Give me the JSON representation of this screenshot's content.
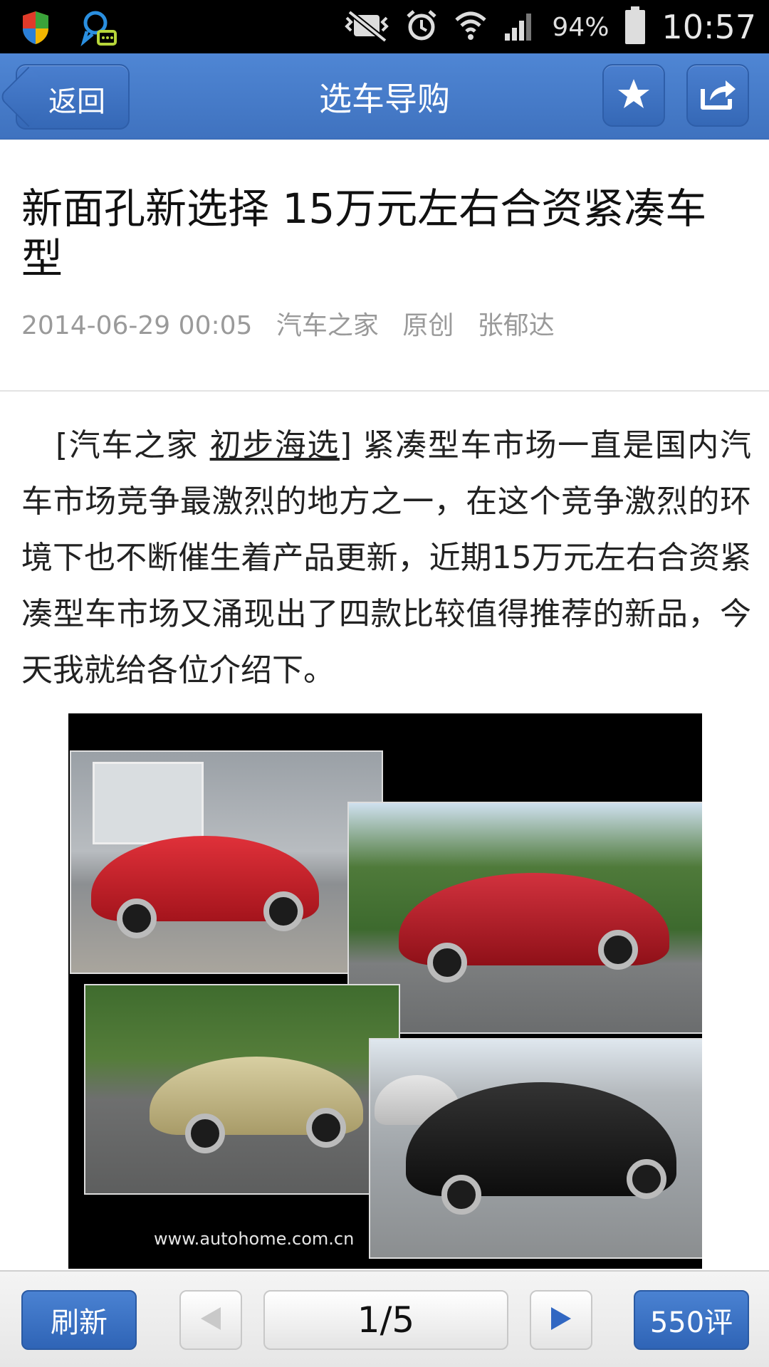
{
  "status_bar": {
    "battery_percent": "94%",
    "time": "10:57",
    "icons": [
      "shield-icon",
      "chat-notification-icon",
      "mute-icon",
      "alarm-icon",
      "wifi-icon",
      "signal-icon",
      "battery-icon"
    ]
  },
  "header": {
    "back_label": "返回",
    "title": "选车导购",
    "actions": [
      "star-icon",
      "share-icon"
    ]
  },
  "article": {
    "title": "新面孔新选择 15万元左右合资紧凑车型",
    "date": "2014-06-29 00:05",
    "source": "汽车之家",
    "type": "原创",
    "author": "张郁达",
    "lead_bracket_open": "[汽车之家 ",
    "lead_link": "初步海选",
    "lead_bracket_close": "]",
    "body": "  紧凑型车市场一直是国内汽车市场竞争最激烈的地方之一，在这个竞争激烈的环境下也不断催生着产品更新，近期15万元左右合资紧凑型车市场又涌现出了四款比较值得推荐的新品，今天我就给各位介绍下。",
    "image_watermark": "www.autohome.com.cn"
  },
  "toolbar": {
    "refresh_label": "刷新",
    "page_indicator": "1/5",
    "comments_label": "550评"
  },
  "colors": {
    "header_blue": "#4279c9",
    "button_blue": "#3a6fc0"
  }
}
